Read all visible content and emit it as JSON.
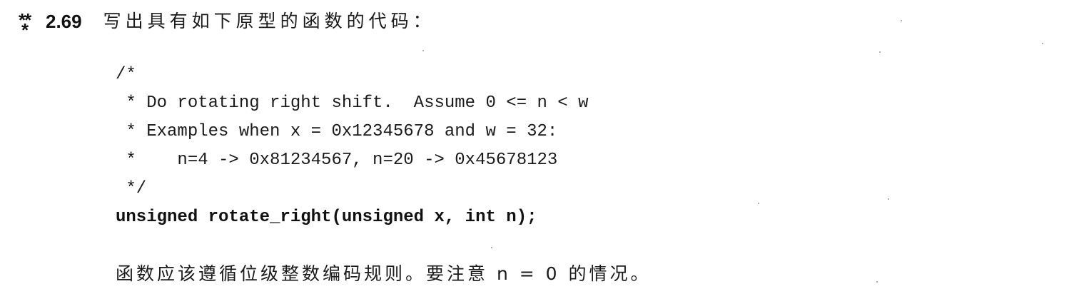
{
  "problem": {
    "stars": "**",
    "star_bottom": "*",
    "number": "2.69",
    "title": "写出具有如下原型的函数的代码："
  },
  "code": {
    "lines": [
      "/*",
      " * Do rotating right shift.  Assume 0 <= n < w",
      " * Examples when x = 0x12345678 and w = 32:",
      " *    n=4 -> 0x81234567, n=20 -> 0x45678123",
      " */"
    ],
    "signature": "unsigned rotate_right(unsigned x, int n);"
  },
  "note": "函数应该遵循位级整数编码规则。要注意 n = 0 的情况。",
  "colors": {
    "text": "#1a1a1a",
    "background": "#ffffff"
  }
}
